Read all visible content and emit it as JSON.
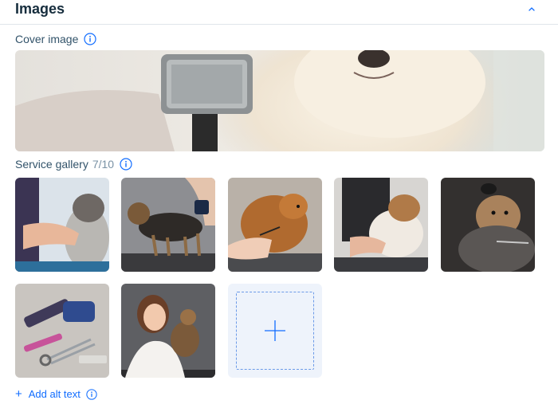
{
  "section": {
    "title": "Images",
    "collapse_icon": "chevron-up-icon"
  },
  "cover": {
    "label": "Cover image",
    "info_icon": "info-icon",
    "image": "dog-with-grooming-brush"
  },
  "gallery": {
    "label": "Service gallery",
    "count": "7/10",
    "info_icon": "info-icon",
    "images": [
      "dog-being-groomed",
      "yorkshire-terrier-on-table",
      "pomeranian-with-scissors",
      "bulldog-being-brushed",
      "yorkie-with-bow",
      "grooming-tools-flatlay",
      "woman-holding-dog"
    ],
    "add_icon": "plus-icon"
  },
  "alt_text": {
    "label": "Add alt text",
    "plus": "+",
    "info_icon": "info-icon"
  },
  "colors": {
    "accent": "#116dff",
    "text": "#162d3d",
    "muted": "#7a92a5",
    "divider": "#dfe5eb",
    "add_tile_bg": "#eef3fb"
  }
}
